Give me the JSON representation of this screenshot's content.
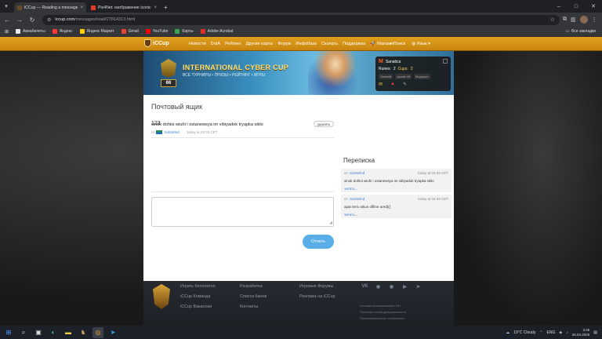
{
  "browser": {
    "tabs": [
      {
        "title": "iCCup — Reading a message fr",
        "fav_color": "#6b4a2a",
        "active": true
      },
      {
        "title": "Pix4Net: изображение iconic.g",
        "fav_color": "#e23b2e",
        "active": false
      }
    ],
    "url_host": "iccup.com",
    "url_path": "/messages/read/27814313.html",
    "bookmarks": [
      {
        "label": "Авиабилеты",
        "color": "#e8e8e8"
      },
      {
        "label": "Яндекс",
        "color": "#ff3333"
      },
      {
        "label": "Яндекс Маркет",
        "color": "#ffcc00"
      },
      {
        "label": "Gmail",
        "color": "#ea4335"
      },
      {
        "label": "YouTube",
        "color": "#ff0000"
      },
      {
        "label": "Карты",
        "color": "#34a853"
      },
      {
        "label": "Adobe Acrobat",
        "color": "#d93025"
      }
    ],
    "all_bookmarks": "Все закладки"
  },
  "site": {
    "logo": "iCCup",
    "menu": [
      "Новости",
      "DotA",
      "Рейтинг",
      "Другие карты",
      "Форум",
      "Инфобаза",
      "Скачать",
      "Поддержка",
      "Магазин"
    ],
    "search_label": "Поиск",
    "language_label": "Язык",
    "banner": {
      "title": "INTERNATIONAL CYBER CUP",
      "subtitle": "ВСЕ ТУРНИРЫ • ПРИЗЫ • РЕЙТИНГ • ИГРЫ",
      "level": "66"
    },
    "user": {
      "name": "Sanatica",
      "runes_label": "Runes:",
      "runes_value": "2",
      "cups_label": "Cups:",
      "cups_value": "2",
      "tags": [
        "Личный",
        "Архив off",
        "Модерат."
      ]
    }
  },
  "page": {
    "title": "Почтовый ящик",
    "message": {
      "subject": "123",
      "delete_label": "удалить",
      "from_prefix": "от",
      "author": "SoloWind",
      "date": "today at 04:33 CET",
      "body": "sinok dohloi wiuhi i ostanewsya im vibiyadok tryapka siklo"
    },
    "send_label": "Отпеть",
    "sidebar": {
      "title": "Переписка",
      "threads": [
        {
          "from_prefix": "от:",
          "from": "SoloWind",
          "date": "today at 04:33 CET",
          "text": "sinok dohloi wiuhi i ostanewsya im vibiyadok tryapka siklo",
          "read_label": "читать..."
        },
        {
          "from_prefix": "от:",
          "from": "SoloWind",
          "date": "today at 04:33 CET",
          "text": "apar terru sikun offiine ured(((",
          "read_label": "читать..."
        }
      ]
    }
  },
  "footer": {
    "col1": [
      "Играть бесплатно",
      "iCCup Команда",
      "iCCup Вакансии"
    ],
    "col2": [
      "Разработка",
      "Список банов",
      "Контакты"
    ],
    "col3": [
      "Игровые Форумы",
      "Реклама на iCCup"
    ],
    "social": [
      "vk-icon",
      "discord-icon",
      "discord-icon",
      "youtube-icon",
      "telegram-icon"
    ],
    "legal": [
      "Условия использования 18+",
      "Политика конфиденциальности",
      "Пользовательское соглашение"
    ]
  },
  "taskbar": {
    "weather": "19°C  Cloudy",
    "lang": "ENG",
    "time": "3:25",
    "date": "26.04.2026"
  }
}
